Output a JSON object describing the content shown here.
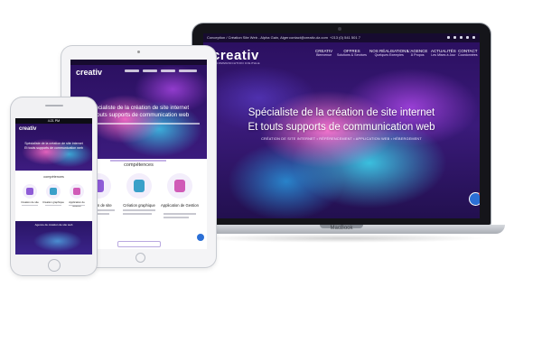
{
  "laptop": {
    "brand": "MacBook",
    "topbar": {
      "address": "Conception / Création Site Web - Alpha Gain, Alger",
      "email": "contact@creativ-dz.com",
      "phone": "+213 (0) 541 501 7"
    },
    "logo": "creativ",
    "logo_sub": "COMMUNICATION DIGITALE",
    "nav": [
      {
        "label": "CREATIV",
        "sub": "Bienvenue"
      },
      {
        "label": "OFFRES",
        "sub": "Solutions & Services"
      },
      {
        "label": "NOS RÉALISATIONS",
        "sub": "Quelques Exemples"
      },
      {
        "label": "L'AGENCE",
        "sub": "À Propos"
      },
      {
        "label": "ACTUALITÉS",
        "sub": "Les Mises à Jour"
      },
      {
        "label": "CONTACT",
        "sub": "Coordonnées"
      }
    ],
    "hero": {
      "line1": "Spécialiste de la création de site internet",
      "line2": "Et touts supports de communication web",
      "tagline": "CRÉATION DE SITE INTERNET • RÉFÉRENCEMENT • APPLICATION WEB • HÉBERGEMENT"
    }
  },
  "tablet": {
    "logo": "creativ",
    "hero": {
      "line1": "Spécialiste de la création de site internet",
      "line2": "Et touts supports de communication web"
    },
    "section_title": "compétences",
    "cards": [
      {
        "title": "Création de site",
        "icon_color": "#8e5bd6"
      },
      {
        "title": "Création graphique",
        "icon_color": "#3aa0c9"
      },
      {
        "title": "Application de Gestion",
        "icon_color": "#d05bb7"
      }
    ]
  },
  "phone": {
    "time": "4:21 PM",
    "logo": "creativ",
    "hero": {
      "line1": "Spécialiste de la création de site internet",
      "line2": "Et touts supports de communication web"
    },
    "section_title": "compétences",
    "cards": [
      {
        "title": "Création de site",
        "icon_color": "#8e5bd6"
      },
      {
        "title": "Création graphique",
        "icon_color": "#3aa0c9"
      },
      {
        "title": "Application de Gestion",
        "icon_color": "#d05bb7"
      }
    ],
    "banner": {
      "line1": "Agence de création de site web",
      "line2": ""
    }
  },
  "colors": {
    "brand_purple": "#3a1a7a",
    "accent_pink": "#ff78d2",
    "accent_cyan": "#3cd2eb",
    "chat_blue": "#2b6fd6"
  }
}
